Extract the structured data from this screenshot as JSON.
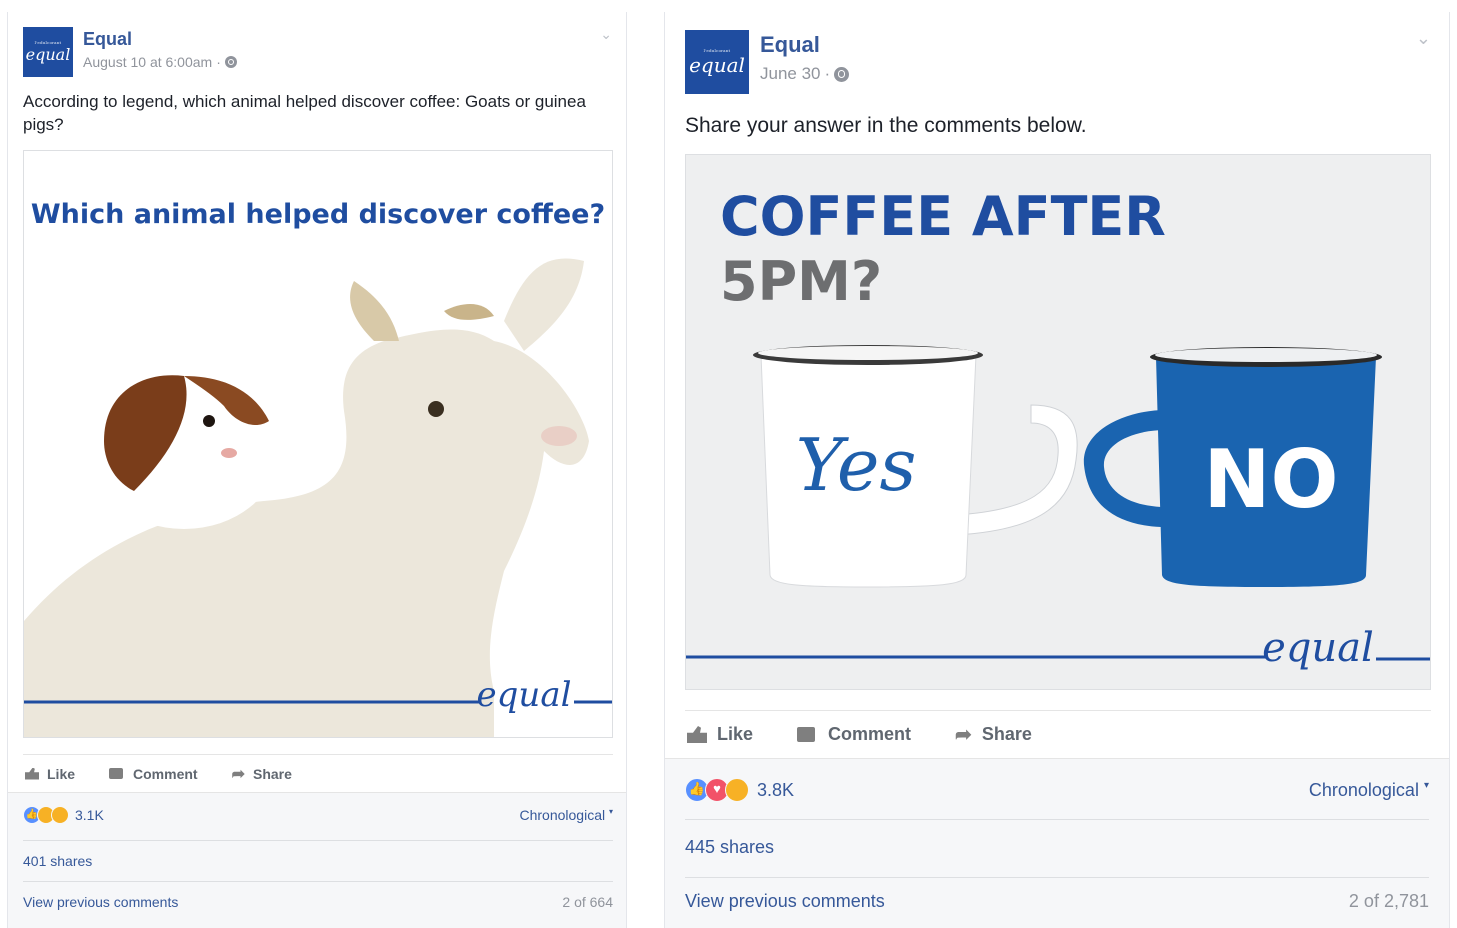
{
  "posts": [
    {
      "page_name": "Equal",
      "logo_text": "equal",
      "logo_tagline": "l'edulcorant",
      "timestamp": "August 10 at 6:00am",
      "caption": "According to legend, which animal helped discover coffee: Goats or guinea pigs?",
      "image": {
        "headline": "Which animal helped discover coffee?",
        "brand": "equal"
      },
      "actions": {
        "like": "Like",
        "comment": "Comment",
        "share": "Share"
      },
      "reactions_count": "3.1K",
      "reaction_icons": [
        "like-icon",
        "haha-icon",
        "wow-icon"
      ],
      "sort_label": "Chronological",
      "shares": "401 shares",
      "view_previous": "View previous comments",
      "comment_count": "2 of 664"
    },
    {
      "page_name": "Equal",
      "logo_text": "equal",
      "logo_tagline": "l'edulcorant",
      "timestamp": "June 30",
      "caption": "Share your answer in the comments below.",
      "image": {
        "headline_line1": "COFFEE AFTER",
        "headline_line2": "5PM?",
        "mug_yes": "Yes",
        "mug_no": "NO",
        "brand": "equal"
      },
      "actions": {
        "like": "Like",
        "comment": "Comment",
        "share": "Share"
      },
      "reactions_count": "3.8K",
      "reaction_icons": [
        "like-icon",
        "love-icon",
        "haha-icon"
      ],
      "sort_label": "Chronological",
      "shares": "445 shares",
      "view_previous": "View previous comments",
      "comment_count": "2 of 2,781"
    }
  ],
  "colors": {
    "brand_blue": "#1f4da0",
    "fb_link": "#365899",
    "mug_blue": "#1a64b0"
  }
}
